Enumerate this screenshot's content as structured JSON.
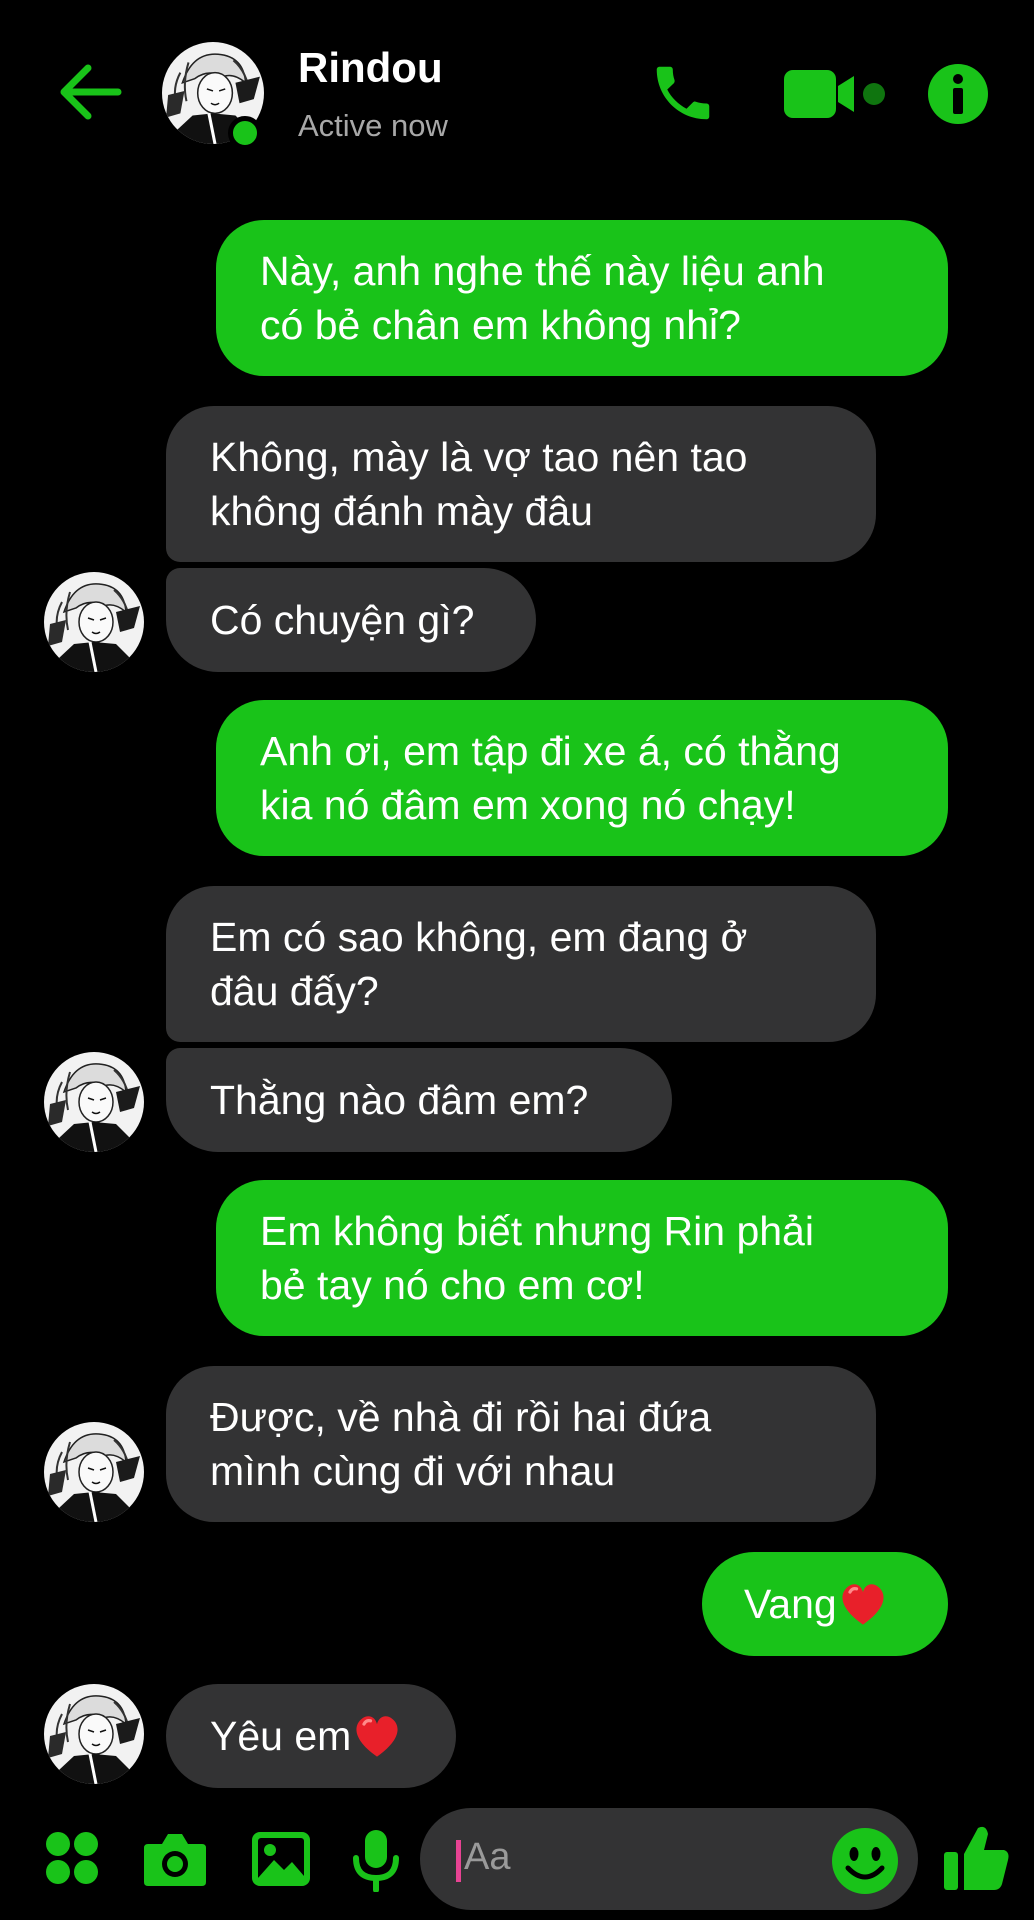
{
  "colors": {
    "accent": "#19c319",
    "sent_bubble": "#19c319",
    "received_bubble": "#333334",
    "background": "#000000",
    "status_text": "#a8a8a8",
    "heart": "#e8202a"
  },
  "header": {
    "name": "Rindou",
    "status": "Active now",
    "icons": [
      "back-arrow-icon",
      "phone-icon",
      "video-camera-icon",
      "info-icon"
    ]
  },
  "messages": [
    {
      "from": "me",
      "lines": [
        "Này, anh nghe thế này liệu anh",
        "có bẻ chân em không nhỉ?"
      ]
    },
    {
      "from": "them",
      "lines": [
        "Không, mày là vợ tao nên tao",
        "không đánh mày đâu"
      ]
    },
    {
      "from": "them",
      "lines": [
        "Có chuyện gì?"
      ]
    },
    {
      "from": "me",
      "lines": [
        "Anh ơi, em tập đi xe á, có thằng",
        "kia nó đâm em xong nó chạy!"
      ]
    },
    {
      "from": "them",
      "lines": [
        "Em có sao không, em đang ở",
        "đâu đấy?"
      ]
    },
    {
      "from": "them",
      "lines": [
        "Thằng nào đâm em?"
      ]
    },
    {
      "from": "me",
      "lines": [
        "Em không biết nhưng Rin phải",
        "bẻ tay nó cho em cơ!"
      ]
    },
    {
      "from": "them",
      "lines": [
        "Được, về nhà đi rồi hai đứa",
        "mình cùng đi với nhau"
      ]
    },
    {
      "from": "me",
      "lines": [
        "Vang"
      ],
      "emoji": "heart"
    },
    {
      "from": "them",
      "lines": [
        "Yêu em"
      ],
      "emoji": "heart"
    }
  ],
  "composer": {
    "placeholder": "Aa",
    "icons": [
      "apps-icon",
      "camera-icon",
      "image-icon",
      "microphone-icon",
      "emoji-icon",
      "thumbs-up-icon"
    ]
  }
}
